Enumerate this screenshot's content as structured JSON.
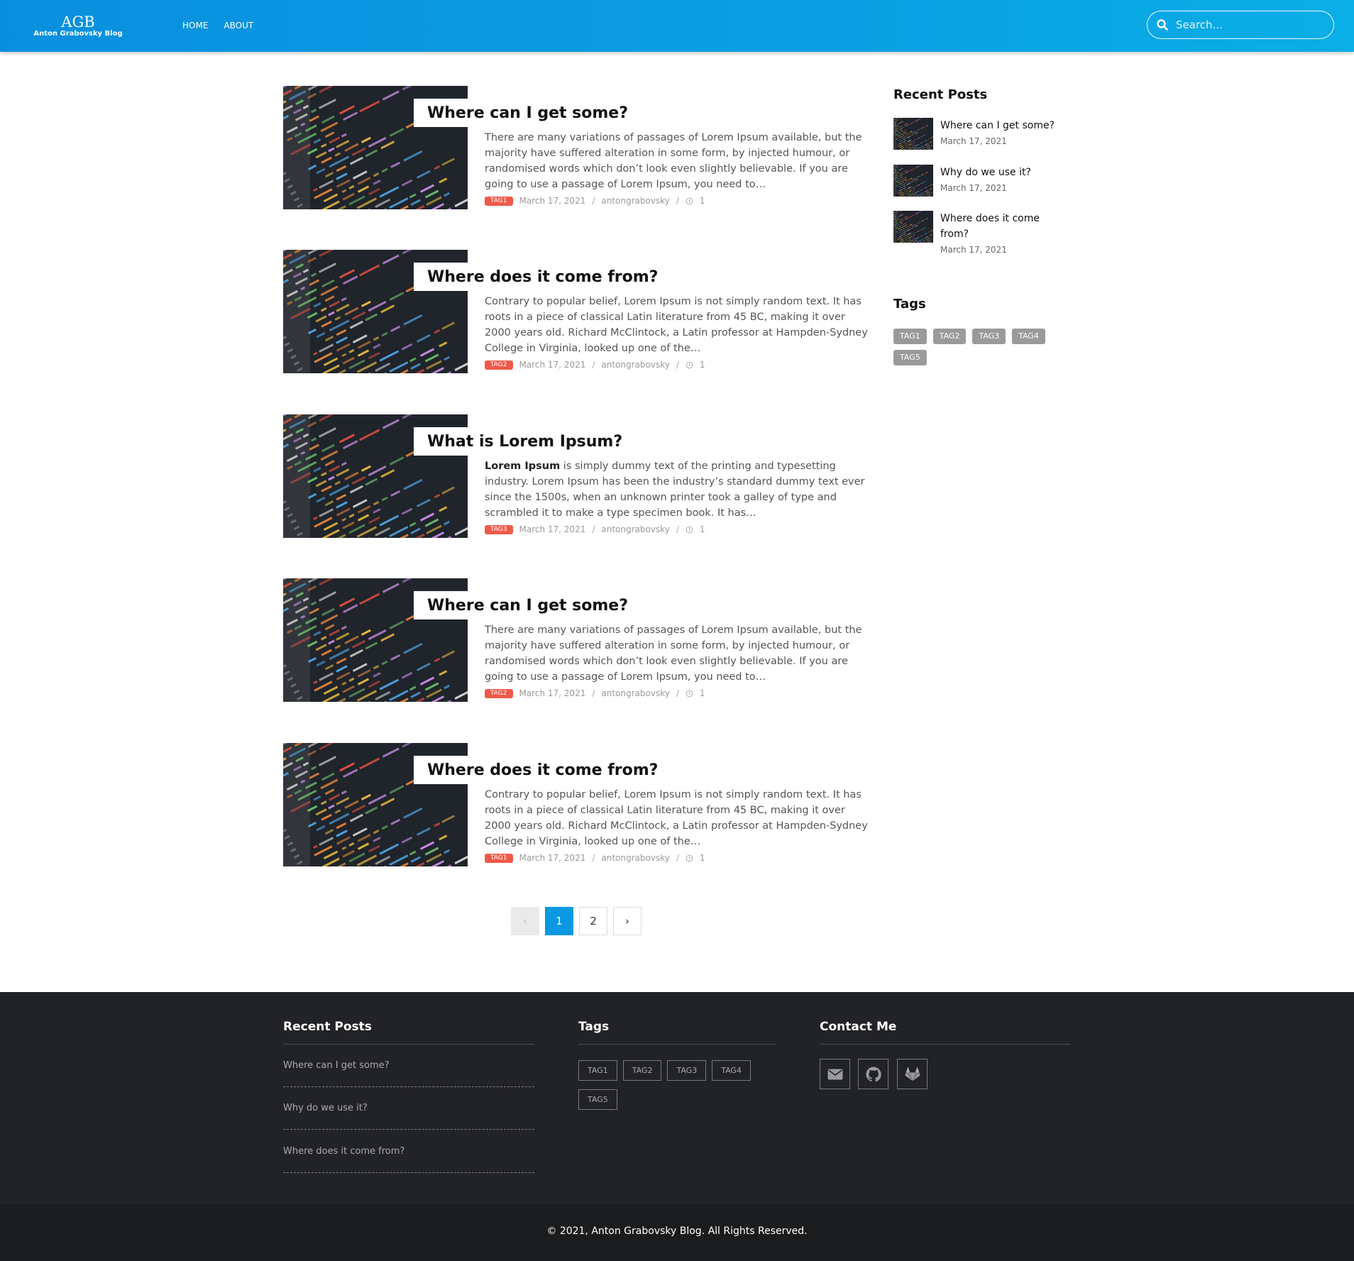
{
  "header": {
    "logo_mark": "AGB",
    "logo_sub": "Anton Grabovsky Blog",
    "nav": [
      "HOME",
      "ABOUT"
    ],
    "search_placeholder": "Search...",
    "colors": {
      "primary": "#0a98e2",
      "tag_red": "#ee5a4a"
    }
  },
  "posts": [
    {
      "title": "Where can I get some?",
      "excerpt": "There are many variations of passages of Lorem Ipsum available, but the majority have suffered alteration in some form, by injected humour, or randomised words which don’t look even slightly believable. If you are going to use a passage of Lorem Ipsum, you need to…",
      "tag": "TAG1",
      "date": "March 17, 2021",
      "author": "antongrabovsky",
      "views": "1"
    },
    {
      "title": "Where does it come from?",
      "excerpt": "Contrary to popular belief, Lorem Ipsum is not simply random text. It has roots in a piece of classical Latin literature from 45 BC, making it over 2000 years old. Richard McClintock, a Latin professor at Hampden-Sydney College in Virginia, looked up one of the…",
      "tag": "TAG2",
      "date": "March 17, 2021",
      "author": "antongrabovsky",
      "views": "1"
    },
    {
      "title": "What is Lorem Ipsum?",
      "excerpt_bold": "Lorem Ipsum",
      "excerpt": " is simply dummy text of the printing and typesetting industry. Lorem Ipsum has been the industry’s standard dummy text ever since the 1500s, when an unknown printer took a galley of type and scrambled it to make a type specimen book. It has…",
      "tag": "TAG3",
      "date": "March 17, 2021",
      "author": "antongrabovsky",
      "views": "1"
    },
    {
      "title": "Where can I get some?",
      "excerpt": "There are many variations of passages of Lorem Ipsum available, but the majority have suffered alteration in some form, by injected humour, or randomised words which don’t look even slightly believable. If you are going to use a passage of Lorem Ipsum, you need to…",
      "tag": "TAG2",
      "date": "March 17, 2021",
      "author": "antongrabovsky",
      "views": "1"
    },
    {
      "title": "Where does it come from?",
      "excerpt": "Contrary to popular belief, Lorem Ipsum is not simply random text. It has roots in a piece of classical Latin literature from 45 BC, making it over 2000 years old. Richard McClintock, a Latin professor at Hampden-Sydney College in Virginia, looked up one of the…",
      "tag": "TAG1",
      "date": "March 17, 2021",
      "author": "antongrabovsky",
      "views": "1"
    }
  ],
  "meta_separator": "/",
  "pagination": {
    "prev": "‹",
    "pages": [
      "1",
      "2"
    ],
    "current": "1",
    "next": "›"
  },
  "sidebar": {
    "recent_heading": "Recent Posts",
    "recent": [
      {
        "title": "Where can I get some?",
        "date": "March 17, 2021"
      },
      {
        "title": "Why do we use it?",
        "date": "March 17, 2021"
      },
      {
        "title": "Where does it come from?",
        "date": "March 17, 2021"
      }
    ],
    "tags_heading": "Tags",
    "tags": [
      "TAG1",
      "TAG2",
      "TAG3",
      "TAG4",
      "TAG5"
    ]
  },
  "footer": {
    "recent_heading": "Recent Posts",
    "recent": [
      "Where can I get some?",
      "Why do we use it?",
      "Where does it come from?"
    ],
    "tags_heading": "Tags",
    "tags": [
      "TAG1",
      "TAG2",
      "TAG3",
      "TAG4",
      "TAG5"
    ],
    "contact_heading": "Contact Me",
    "contact_icons": [
      "envelope-icon",
      "github-icon",
      "gitlab-icon"
    ],
    "copyright": "© 2021, Anton Grabovsky Blog. All Rights Reserved."
  }
}
